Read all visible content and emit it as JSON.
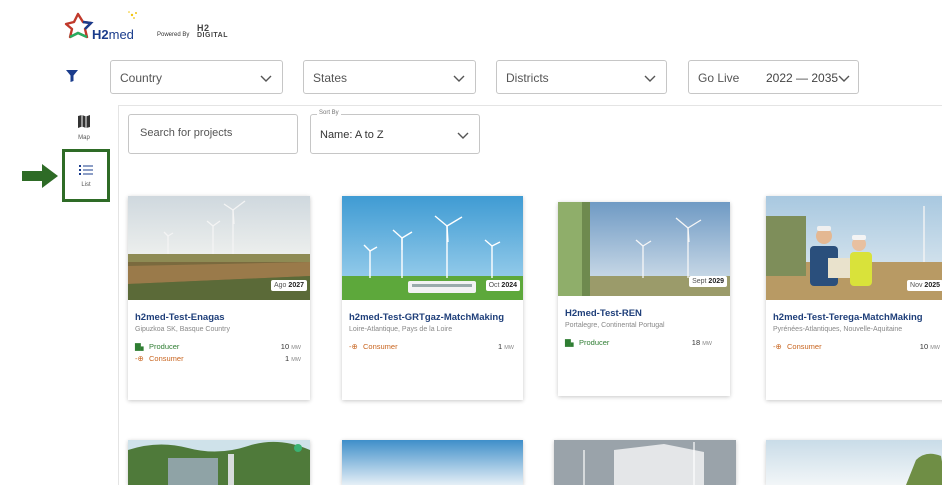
{
  "header": {
    "logo_h2": "H2",
    "logo_med": "med",
    "powered_by": "Powered By",
    "digital_top": "H2",
    "digital_bottom": "DIGITAL"
  },
  "filters": {
    "country": "Country",
    "states": "States",
    "districts": "Districts",
    "golive_label": "Go Live",
    "golive_value": "2022 — 2035"
  },
  "sidenav": {
    "map_label": "Map",
    "list_label": "List"
  },
  "search": {
    "placeholder": "Search for projects"
  },
  "sort": {
    "legend": "Sort By",
    "value": "Name: A to Z"
  },
  "units": {
    "mw": "MW"
  },
  "projects": [
    {
      "badge_month": "Ago",
      "badge_year": "2027",
      "title": "h2med-Test-Enagas",
      "location": "Gipuzkoa SK, Basque Country",
      "producer_label": "Producer",
      "producer_mw": "10",
      "consumer_label": "Consumer",
      "consumer_mw": "1"
    },
    {
      "badge_month": "Oct",
      "badge_year": "2024",
      "title": "h2med-Test-GRTgaz-MatchMaking",
      "location": "Loire-Atlantique, Pays de la Loire",
      "consumer_label": "Consumer",
      "consumer_mw": "1"
    },
    {
      "badge_month": "Sept",
      "badge_year": "2029",
      "title": "H2med-Test-REN",
      "location": "Portalegre, Continental Portugal",
      "producer_label": "Producer",
      "producer_mw": "18"
    },
    {
      "badge_month": "Nov",
      "badge_year": "2025",
      "title": "h2med-Test-Terega-MatchMaking",
      "location": "Pyrénées-Atlantiques, Nouvelle-Aquitaine",
      "consumer_label": "Consumer",
      "consumer_mw": "10"
    }
  ],
  "colors": {
    "title_blue": "#1f3f7a",
    "producer_green": "#2e7d32",
    "consumer_orange": "#c8641e",
    "highlight_green": "#2e6b26"
  }
}
